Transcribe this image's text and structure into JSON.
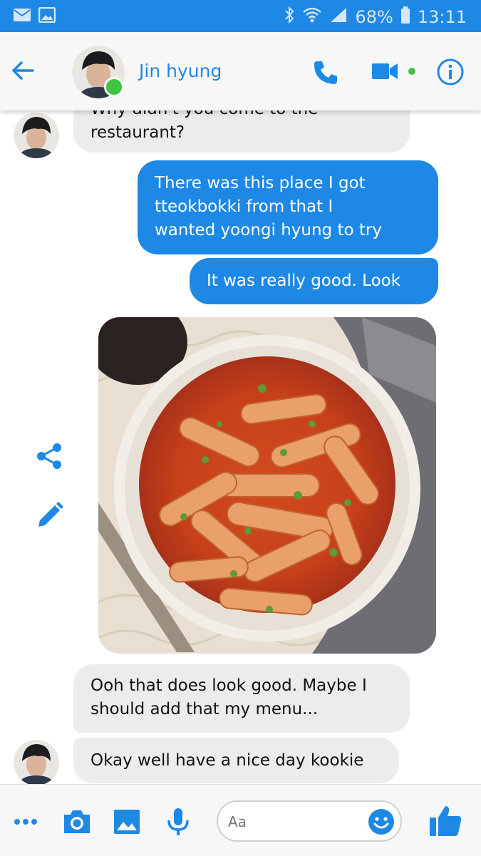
{
  "status_bar": {
    "battery": "68%",
    "time": "13:11"
  },
  "header": {
    "contact_name": "Jin hyung"
  },
  "messages": [
    {
      "side": "in",
      "text_line1": "Why didn't you come to the",
      "text_line2": "restaurant?"
    },
    {
      "side": "out",
      "lines": [
        "There was this place I got",
        "tteokbokki from that I",
        "wanted yoongi hyung to try"
      ]
    },
    {
      "side": "out",
      "text": "It was really good. Look"
    },
    {
      "side": "in",
      "lines": [
        "Ooh that does look good. Maybe I",
        "should add that my menu..."
      ]
    },
    {
      "side": "in",
      "text": "Okay well have a nice day kookie"
    }
  ],
  "composer": {
    "placeholder": "Aa"
  },
  "colors": {
    "accent": "#1e88e5",
    "online": "#3ec43e",
    "incoming_bubble": "#ececec"
  }
}
